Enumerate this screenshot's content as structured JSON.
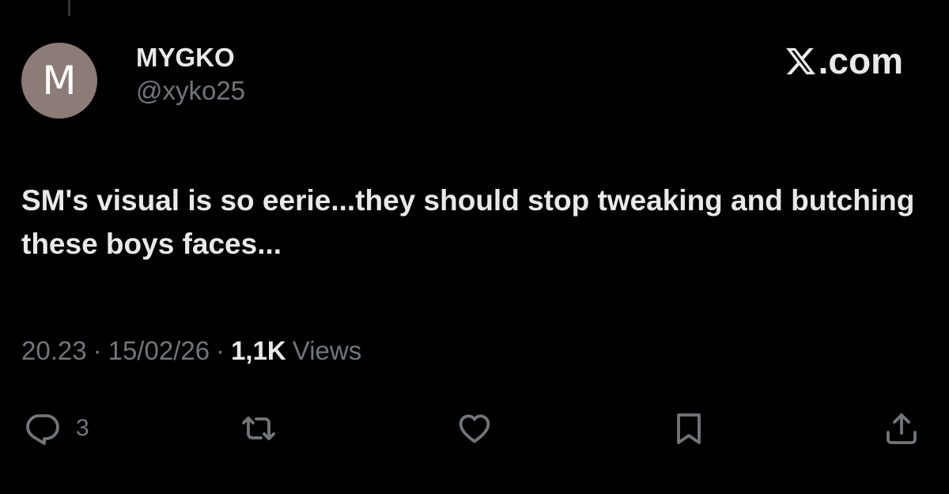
{
  "tweet": {
    "avatar_letter": "M",
    "avatar_color": "#8c7b76",
    "display_name": "MYGKO",
    "handle": "@xyko25",
    "brand": ".com",
    "brand_icon": "x-logo-icon",
    "text": "SM's visual is so eerie...they should stop tweaking and butching these boys faces...",
    "meta": {
      "time": "20.23",
      "separator": "·",
      "date": "15/02/26",
      "views_count": "1,1K",
      "views_label": "Views"
    },
    "actions": {
      "reply_icon": "reply-icon",
      "reply_count": "3",
      "repost_icon": "repost-icon",
      "like_icon": "like-heart-icon",
      "bookmark_icon": "bookmark-icon",
      "share_icon": "share-icon"
    },
    "colors": {
      "background": "#000000",
      "text": "#e7e9ea",
      "muted": "#71767b"
    }
  }
}
